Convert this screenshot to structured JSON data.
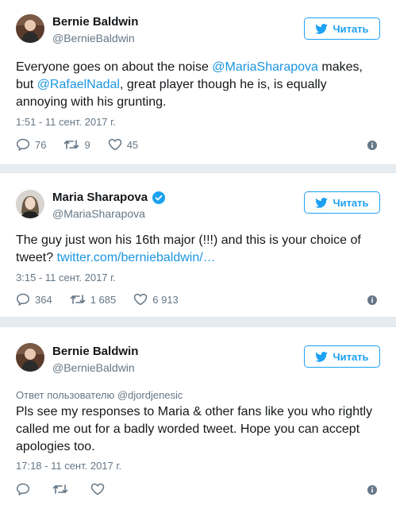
{
  "follow_label": "Читать",
  "colors": {
    "accent": "#1da1f2",
    "link": "#1b95e0",
    "muted": "#657786",
    "background": "#e6ecf0"
  },
  "tweets": [
    {
      "name": "Bernie Baldwin",
      "handle": "@BernieBaldwin",
      "verified": false,
      "text_parts": [
        "Everyone goes on about the noise ",
        "@MariaSharapova",
        " makes, but ",
        "@RafaelNadal",
        ", great player though he is, is equally annoying with his grunting."
      ],
      "time": "1:51 - 11 сент. 2017 г.",
      "replies": "76",
      "retweets": "9",
      "likes": "45"
    },
    {
      "name": "Maria Sharapova",
      "handle": "@MariaSharapova",
      "verified": true,
      "text_parts": [
        "The guy just won his 16th major (!!!) and this is your choice of tweet? ",
        "twitter.com/berniebaldwin/…"
      ],
      "time": "3:15 - 11 сент. 2017 г.",
      "replies": "364",
      "retweets": "1 685",
      "likes": "6 913"
    },
    {
      "name": "Bernie Baldwin",
      "handle": "@BernieBaldwin",
      "verified": false,
      "replying_prefix": "Ответ пользователю ",
      "replying_to": "@djordjenesic",
      "text_parts": [
        "Pls see my responses to Maria & other fans like you who rightly called me out for a badly worded tweet. Hope you can accept apologies too."
      ],
      "time": "17:18 - 11 сент. 2017 г.",
      "replies": "",
      "retweets": "",
      "likes": ""
    }
  ]
}
